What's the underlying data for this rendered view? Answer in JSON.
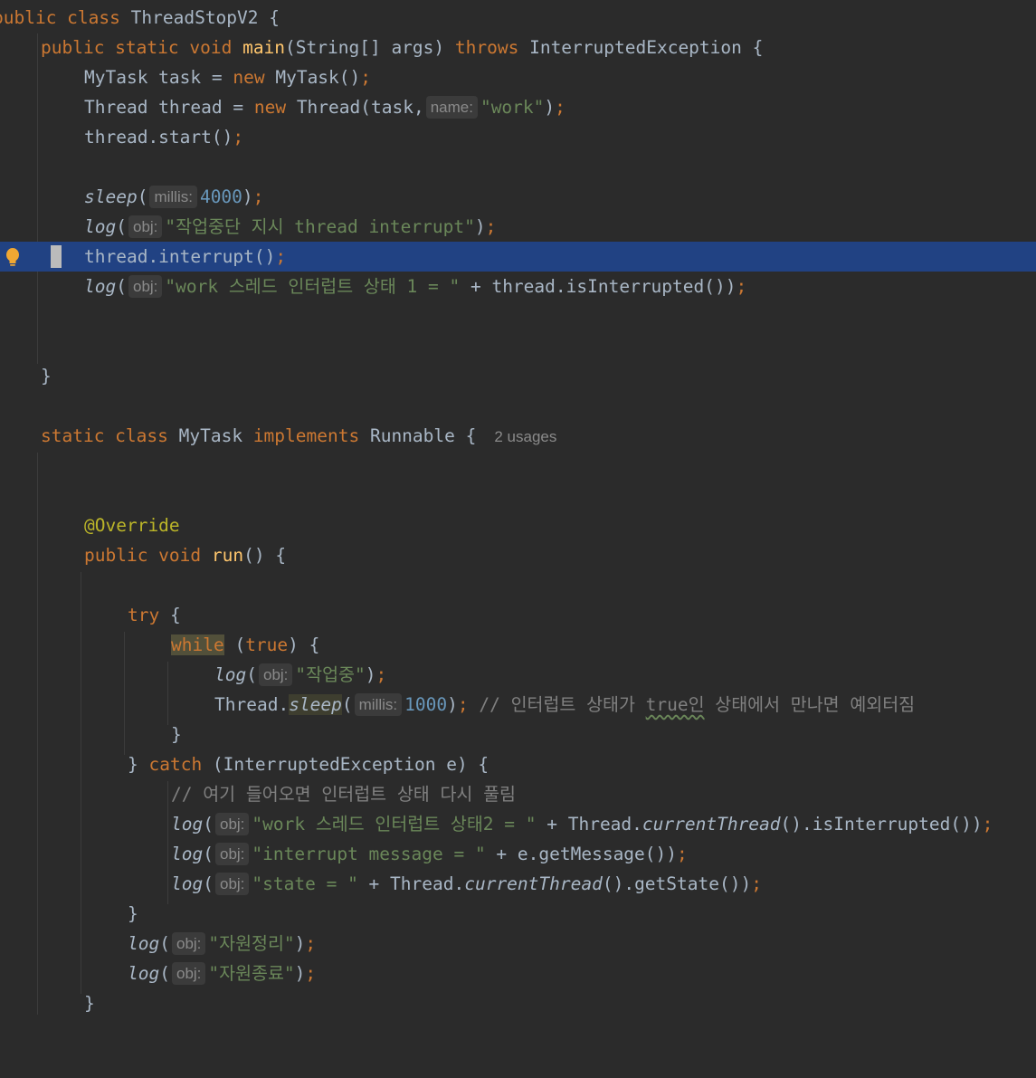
{
  "editor": {
    "language": "Java",
    "colors": {
      "background": "#2b2b2b",
      "current_line": "#214283",
      "keyword": "#cc7832",
      "string": "#6a8759",
      "number": "#6897bb",
      "function": "#ffc66d",
      "comment": "#808080",
      "annotation": "#bbb529",
      "text": "#a9b7c6",
      "hint": "#8a8a8a"
    },
    "gutter_icon": "lightbulb-icon",
    "current_line_number": 9,
    "lines": {
      "l1": {
        "kw1": "public class",
        "name": "ThreadStopV2",
        "rest": " {"
      },
      "l2": {
        "kw1": "public static void",
        "fn": "main",
        "sig": "(String[] args) ",
        "kw2": "throws",
        "rest": " InterruptedException {"
      },
      "l3": {
        "a": "MyTask task = ",
        "kw": "new",
        "b": " MyTask()",
        "semi": ";"
      },
      "l4": {
        "a": "Thread thread = ",
        "kw": "new",
        "b": " Thread(task,",
        "hint": "name:",
        "str": "\"work\"",
        "c": ")",
        "semi": ";"
      },
      "l5": {
        "a": "thread.start()",
        "semi": ";"
      },
      "l7": {
        "fn": "sleep",
        "open": "(",
        "hint": "millis:",
        "num": "4000",
        "close": ")",
        "semi": ";"
      },
      "l8": {
        "fn": "log",
        "open": "(",
        "hint": "obj:",
        "str": "\"작업중단 지시 thread interrupt\"",
        "close": ")",
        "semi": ";"
      },
      "l9": {
        "a": "thread.interrupt()",
        "semi": ";"
      },
      "l10": {
        "fn": "log",
        "open": "(",
        "hint": "obj:",
        "str": "\"work 스레드 인터럽트 상태 1 = \"",
        "b": " + thread.isInterrupted())",
        "semi": ";"
      },
      "l13": {
        "a": "}"
      },
      "l15": {
        "kw1": "static class",
        "name": " MyTask ",
        "kw2": "implements",
        "rest": " Runnable {",
        "usages": "2 usages"
      },
      "l18": {
        "ann": "@Override"
      },
      "l19": {
        "kw": "public void",
        "fn": "run",
        "rest": "() {"
      },
      "l21": {
        "kw": "try",
        "rest": " {"
      },
      "l22": {
        "kw": "while",
        "a": " (",
        "kw2": "true",
        "b": ") {"
      },
      "l23": {
        "fn": "log",
        "open": "(",
        "hint": "obj:",
        "str": "\"작업중\"",
        "close": ")",
        "semi": ";"
      },
      "l24": {
        "a": "Thread.",
        "fn": "sleep",
        "open": "(",
        "hint": "millis:",
        "num": "1000",
        "close": ")",
        "semi": ";",
        "cm1": " // 인터럽트 상태가 ",
        "cm_sq": "true인",
        "cm2": " 상태에서 만나면 예외터짐"
      },
      "l25": {
        "a": "}"
      },
      "l26": {
        "a": "} ",
        "kw": "catch",
        "b": " (InterruptedException e) {"
      },
      "l27": {
        "cm": "// 여기 들어오면 인터럽트 상태 다시 풀림"
      },
      "l28": {
        "fn": "log",
        "open": "(",
        "hint": "obj:",
        "str": "\"work 스레드 인터럽트 상태2 = \"",
        "b": " + Thread.",
        "fn2": "currentThread",
        "c": "().isInterrupted())",
        "semi": ";"
      },
      "l29": {
        "fn": "log",
        "open": "(",
        "hint": "obj:",
        "str": "\"interrupt message = \"",
        "b": " + e.getMessage())",
        "semi": ";"
      },
      "l30": {
        "fn": "log",
        "open": "(",
        "hint": "obj:",
        "str": "\"state = \"",
        "b": " + Thread.",
        "fn2": "currentThread",
        "c": "().getState())",
        "semi": ";"
      },
      "l31": {
        "a": "}"
      },
      "l32": {
        "fn": "log",
        "open": "(",
        "hint": "obj:",
        "str": "\"자원정리\"",
        "close": ")",
        "semi": ";"
      },
      "l33": {
        "fn": "log",
        "open": "(",
        "hint": "obj:",
        "str": "\"자원종료\"",
        "close": ")",
        "semi": ";"
      },
      "l34": {
        "a": "}"
      }
    }
  }
}
